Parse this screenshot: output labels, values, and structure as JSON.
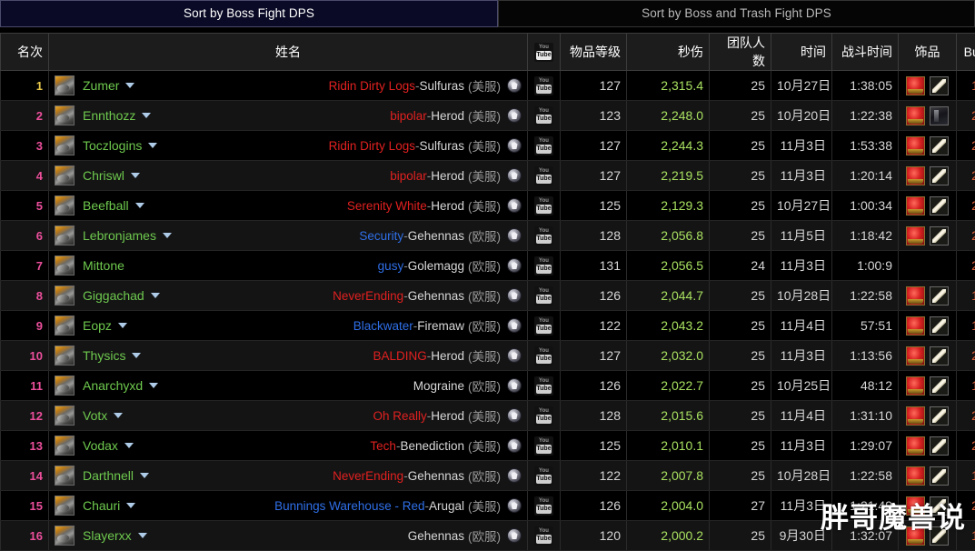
{
  "tabs": [
    {
      "label": "Sort by Boss Fight DPS",
      "active": true
    },
    {
      "label": "Sort by Boss and Trash Fight DPS",
      "active": false
    }
  ],
  "columns": {
    "rank": "名次",
    "name": "姓名",
    "youtube": "youtube-icon",
    "ilvl": "物品等级",
    "dps": "秒伤",
    "raid_size": "团队人数",
    "date": "时间",
    "combat_time": "战斗时间",
    "trinkets": "饰品",
    "buff": "Buff"
  },
  "youtube_icon": {
    "top": "You",
    "bottom": "Tube"
  },
  "colors": {
    "rank_first": "#e8c84a",
    "rank_other": "#ec4f9c",
    "player_name": "#6ec94e",
    "guild_horde": "#e02020",
    "guild_alliance": "#2f6fe8",
    "dps": "#a8e060",
    "buff": "#e0623a",
    "tab_active_bg": "#0a0a26"
  },
  "watermark": "胖哥魔兽说",
  "rows": [
    {
      "rank": "1",
      "name": "Zumer",
      "caret": true,
      "guild": "Ridin Dirty Logs",
      "guild_faction": "horde",
      "realm": "Sulfuras",
      "region": "(美服)",
      "ilvl": "127",
      "dps": "2,315.4",
      "raid": "25",
      "date": "10月27日",
      "ctime": "1:38:05",
      "trinkets": [
        "gem",
        "bone"
      ],
      "buff": "1"
    },
    {
      "rank": "2",
      "name": "Ennthozz",
      "caret": true,
      "guild": "bipolar",
      "guild_faction": "horde",
      "realm": "Herod",
      "region": "(美服)",
      "ilvl": "123",
      "dps": "2,248.0",
      "raid": "25",
      "date": "10月20日",
      "ctime": "1:22:38",
      "trinkets": [
        "gem",
        "dark"
      ],
      "buff": "2"
    },
    {
      "rank": "3",
      "name": "Toczlogins",
      "caret": true,
      "guild": "Ridin Dirty Logs",
      "guild_faction": "horde",
      "realm": "Sulfuras",
      "region": "(美服)",
      "ilvl": "127",
      "dps": "2,244.3",
      "raid": "25",
      "date": "11月3日",
      "ctime": "1:53:38",
      "trinkets": [
        "gem",
        "bone"
      ],
      "buff": "2"
    },
    {
      "rank": "4",
      "name": "Chriswl",
      "caret": true,
      "guild": "bipolar",
      "guild_faction": "horde",
      "realm": "Herod",
      "region": "(美服)",
      "ilvl": "127",
      "dps": "2,219.5",
      "raid": "25",
      "date": "11月3日",
      "ctime": "1:20:14",
      "trinkets": [
        "gem",
        "bone"
      ],
      "buff": "2"
    },
    {
      "rank": "5",
      "name": "Beefball",
      "caret": true,
      "guild": "Serenity White",
      "guild_faction": "horde",
      "realm": "Herod",
      "region": "(美服)",
      "ilvl": "125",
      "dps": "2,129.3",
      "raid": "25",
      "date": "10月27日",
      "ctime": "1:00:34",
      "trinkets": [
        "gem",
        "bone"
      ],
      "buff": "2"
    },
    {
      "rank": "6",
      "name": "Lebronjames",
      "caret": true,
      "guild": "Security",
      "guild_faction": "alliance",
      "realm": "Gehennas",
      "region": "(欧服)",
      "ilvl": "128",
      "dps": "2,056.8",
      "raid": "25",
      "date": "11月5日",
      "ctime": "1:18:42",
      "trinkets": [
        "gem",
        "bone"
      ],
      "buff": "2"
    },
    {
      "rank": "7",
      "name": "Mittone",
      "caret": false,
      "guild": "gusy",
      "guild_faction": "alliance",
      "realm": "Golemagg",
      "region": "(欧服)",
      "ilvl": "131",
      "dps": "2,056.5",
      "raid": "24",
      "date": "11月3日",
      "ctime": "1:00:9",
      "trinkets": [],
      "buff": "2"
    },
    {
      "rank": "8",
      "name": "Giggachad",
      "caret": true,
      "guild": "NeverEnding",
      "guild_faction": "horde",
      "realm": "Gehennas",
      "region": "(欧服)",
      "ilvl": "126",
      "dps": "2,044.7",
      "raid": "25",
      "date": "10月28日",
      "ctime": "1:22:58",
      "trinkets": [
        "gem",
        "bone"
      ],
      "buff": "1"
    },
    {
      "rank": "9",
      "name": "Eopz",
      "caret": true,
      "guild": "Blackwater",
      "guild_faction": "alliance",
      "realm": "Firemaw",
      "region": "(欧服)",
      "ilvl": "122",
      "dps": "2,043.2",
      "raid": "25",
      "date": "11月4日",
      "ctime": "57:51",
      "trinkets": [
        "gem",
        "bone"
      ],
      "buff": "1"
    },
    {
      "rank": "10",
      "name": "Thysics",
      "caret": true,
      "guild": "BALDING",
      "guild_faction": "horde",
      "realm": "Herod",
      "region": "(美服)",
      "ilvl": "127",
      "dps": "2,032.0",
      "raid": "25",
      "date": "11月3日",
      "ctime": "1:13:56",
      "trinkets": [
        "gem",
        "bone"
      ],
      "buff": "2"
    },
    {
      "rank": "11",
      "name": "Anarchyxd",
      "caret": true,
      "guild": "",
      "guild_faction": "none",
      "realm": "Mograine",
      "region": "(欧服)",
      "ilvl": "126",
      "dps": "2,022.7",
      "raid": "25",
      "date": "10月25日",
      "ctime": "48:12",
      "trinkets": [
        "gem",
        "bone"
      ],
      "buff": "1"
    },
    {
      "rank": "12",
      "name": "Votx",
      "caret": true,
      "guild": "Oh Really",
      "guild_faction": "horde",
      "realm": "Herod",
      "region": "(美服)",
      "ilvl": "128",
      "dps": "2,015.6",
      "raid": "25",
      "date": "11月4日",
      "ctime": "1:31:10",
      "trinkets": [
        "gem",
        "bone"
      ],
      "buff": "2"
    },
    {
      "rank": "13",
      "name": "Vodax",
      "caret": true,
      "guild": "Tech",
      "guild_faction": "horde",
      "realm": "Benediction",
      "region": "(美服)",
      "ilvl": "125",
      "dps": "2,010.1",
      "raid": "25",
      "date": "11月3日",
      "ctime": "1:29:07",
      "trinkets": [
        "gem",
        "bone"
      ],
      "buff": "2"
    },
    {
      "rank": "14",
      "name": "Darthnell",
      "caret": true,
      "guild": "NeverEnding",
      "guild_faction": "horde",
      "realm": "Gehennas",
      "region": "(欧服)",
      "ilvl": "122",
      "dps": "2,007.8",
      "raid": "25",
      "date": "10月28日",
      "ctime": "1:22:58",
      "trinkets": [
        "gem",
        "bone"
      ],
      "buff": "1"
    },
    {
      "rank": "15",
      "name": "Chauri",
      "caret": true,
      "guild": "Bunnings Warehouse - Red",
      "guild_faction": "alliance",
      "realm": "Arugal",
      "region": "(美服)",
      "ilvl": "126",
      "dps": "2,004.0",
      "raid": "27",
      "date": "11月3日",
      "ctime": "1:21:49",
      "trinkets": [
        "gem",
        "bone"
      ],
      "buff": "2"
    },
    {
      "rank": "16",
      "name": "Slayerxx",
      "caret": true,
      "guild": "",
      "guild_faction": "none",
      "realm": "Gehennas",
      "region": "(欧服)",
      "ilvl": "120",
      "dps": "2,000.2",
      "raid": "25",
      "date": "9月30日",
      "ctime": "1:32:07",
      "trinkets": [
        "gem",
        "bone"
      ],
      "buff": "1"
    }
  ]
}
